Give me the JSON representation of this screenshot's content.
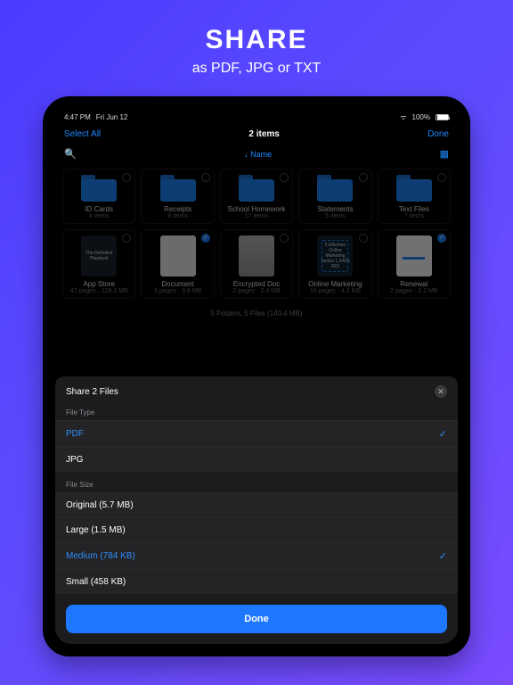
{
  "promo": {
    "title": "SHARE",
    "subtitle": "as PDF, JPG or TXT"
  },
  "status": {
    "time": "4:47 PM",
    "date": "Fri Jun 12",
    "battery": "100%"
  },
  "nav": {
    "select_all": "Select All",
    "title": "2 items",
    "done": "Done"
  },
  "sort": {
    "sort_label": "Name"
  },
  "folders": [
    {
      "name": "ID Cards",
      "meta": "4 items",
      "selected": false
    },
    {
      "name": "Receipts",
      "meta": "8 items",
      "selected": false
    },
    {
      "name": "School Homework",
      "meta": "17 items",
      "selected": false
    },
    {
      "name": "Statements",
      "meta": "5 items",
      "selected": false
    },
    {
      "name": "Text Files",
      "meta": "7 items",
      "selected": false
    }
  ],
  "files": [
    {
      "name": "App Store",
      "meta": "47 pages · 128.1 MB",
      "selected": false,
      "thumb": "dark",
      "thumb_text": "The Definitive Playbook"
    },
    {
      "name": "Document",
      "meta": "3 pages · 3.9 MB",
      "selected": true,
      "thumb": "doc"
    },
    {
      "name": "Encrypted Doc",
      "meta": "2 pages · 2.4 MB",
      "selected": false,
      "thumb": "blur"
    },
    {
      "name": "Online Marketing",
      "meta": "16 pages · 4.2 MB",
      "selected": false,
      "thumb": "mkt",
      "thumb_text": "5 Effective Online Marketing Tactics  1,345% ROI"
    },
    {
      "name": "Renewal",
      "meta": "2 pages · 2.2 MB",
      "selected": true,
      "thumb": "renew"
    }
  ],
  "footer_meta": "5 Folders, 5 Files (140.4 MB)",
  "sheet": {
    "title": "Share 2 Files",
    "file_type_label": "File Type",
    "file_types": [
      {
        "label": "PDF",
        "selected": true
      },
      {
        "label": "JPG",
        "selected": false
      }
    ],
    "file_size_label": "File Size",
    "file_sizes": [
      {
        "label": "Original (5.7 MB)",
        "selected": false
      },
      {
        "label": "Large (1.5 MB)",
        "selected": false
      },
      {
        "label": "Medium (784 KB)",
        "selected": true
      },
      {
        "label": "Small (458 KB)",
        "selected": false
      }
    ],
    "done": "Done"
  }
}
